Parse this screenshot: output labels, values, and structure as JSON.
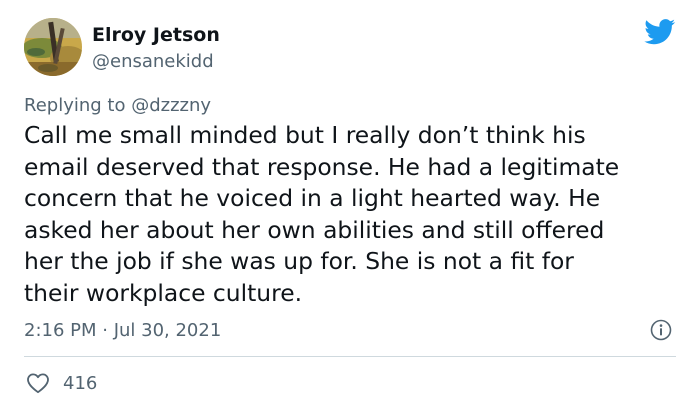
{
  "tweet": {
    "display_name": "Elroy Jetson",
    "handle": "@ensanekidd",
    "replying_prefix": "Replying to ",
    "replying_to": "@dzzzny",
    "lines": [
      "Call me small minded but I really don’t think his",
      "email deserved that response. He had a legitimate",
      "concern that he voiced in a light hearted way. He",
      "asked her about her own abilities and still offered",
      "her the job if she was up for. She is not a fit for",
      "their workplace culture."
    ],
    "timestamp": "2:16 PM · Jul 30, 2021",
    "like_count": "416"
  },
  "icons": {
    "brand": "twitter-bird-icon",
    "info": "info-icon",
    "like": "heart-icon"
  },
  "colors": {
    "brand_blue": "#1d9bf0",
    "text_primary": "#0f1419",
    "text_secondary": "#536471",
    "divider": "#cfd9de"
  }
}
